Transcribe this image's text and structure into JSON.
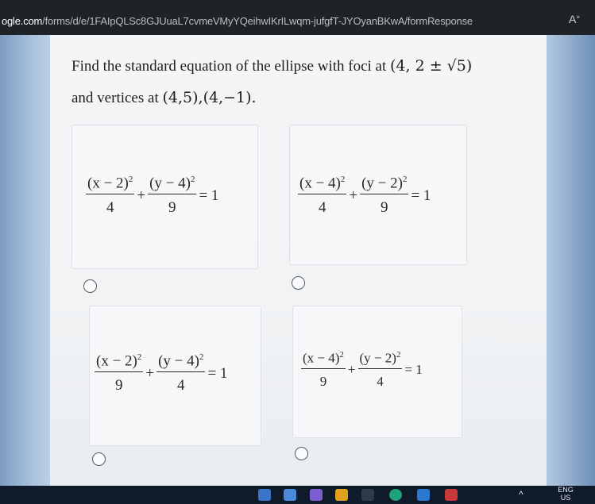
{
  "browser": {
    "url_host": "ogle.com",
    "url_path": "/forms/d/e/1FAIpQLSc8GJUuaL7cvmeVMyYQeihwIKrILwqm-jufgfT-JYOyanBKwA/formResponse",
    "reader_icon": "reader-mode-icon"
  },
  "question": {
    "line1_text": "Find the standard equation of the ellipse with foci at",
    "line1_math": "(4, 2 ± √5)",
    "line2_text": "and vertices at",
    "line2_math": "(4,5),(4,−1)."
  },
  "options": [
    {
      "num1": "(x − 2)",
      "exp1": "2",
      "den1": "4",
      "num2": "(y − 4)",
      "exp2": "2",
      "den2": "9",
      "plus": "+",
      "rhs": "= 1"
    },
    {
      "num1": "(x − 4)",
      "exp1": "2",
      "den1": "4",
      "num2": "(y − 2)",
      "exp2": "2",
      "den2": "9",
      "plus": "+",
      "rhs": "= 1"
    },
    {
      "num1": "(x − 2)",
      "exp1": "2",
      "den1": "9",
      "num2": "(y − 4)",
      "exp2": "2",
      "den2": "4",
      "plus": "+",
      "rhs": "= 1"
    },
    {
      "num1": "(x − 4)",
      "exp1": "2",
      "den1": "9",
      "num2": "(y − 2)",
      "exp2": "2",
      "den2": "4",
      "plus": "+",
      "rhs": "= 1"
    }
  ],
  "taskbar": {
    "lang_top": "ENG",
    "lang_bottom": "US",
    "caret": "^"
  },
  "colors": {
    "taskbar_bg": "#0f1a2a",
    "card_bg": "#f3f5f7"
  }
}
